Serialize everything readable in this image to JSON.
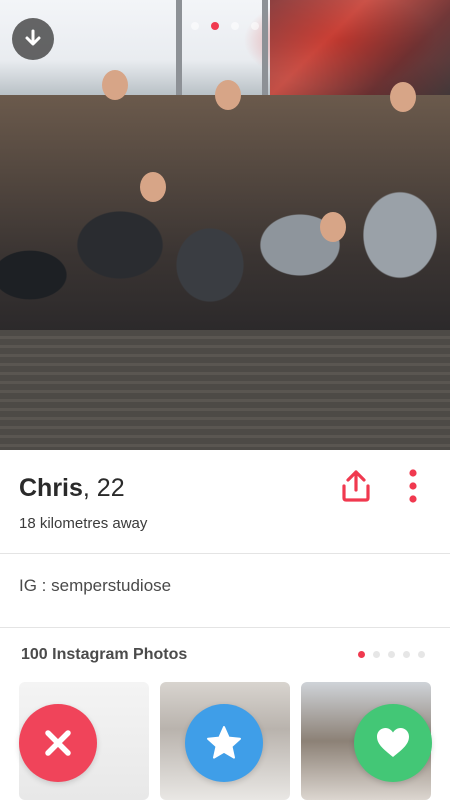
{
  "profile": {
    "name": "Chris",
    "age_text": ", 22",
    "distance": "18 kilometres away",
    "bio": "IG : semperstudiose"
  },
  "photo": {
    "pager_total": 4,
    "pager_active_index": 1
  },
  "instagram": {
    "title": "100 Instagram Photos",
    "pager_total": 5,
    "pager_active_index": 0
  },
  "icons": {
    "download": "download-arrow-icon",
    "share": "share-upload-icon",
    "more": "vertical-dots-icon",
    "nope": "x-icon",
    "superlike": "star-icon",
    "like": "heart-icon"
  },
  "colors": {
    "accent": "#f0394f",
    "nope": "#f0445a",
    "superlike": "#3f9ee8",
    "like": "#43c776"
  }
}
